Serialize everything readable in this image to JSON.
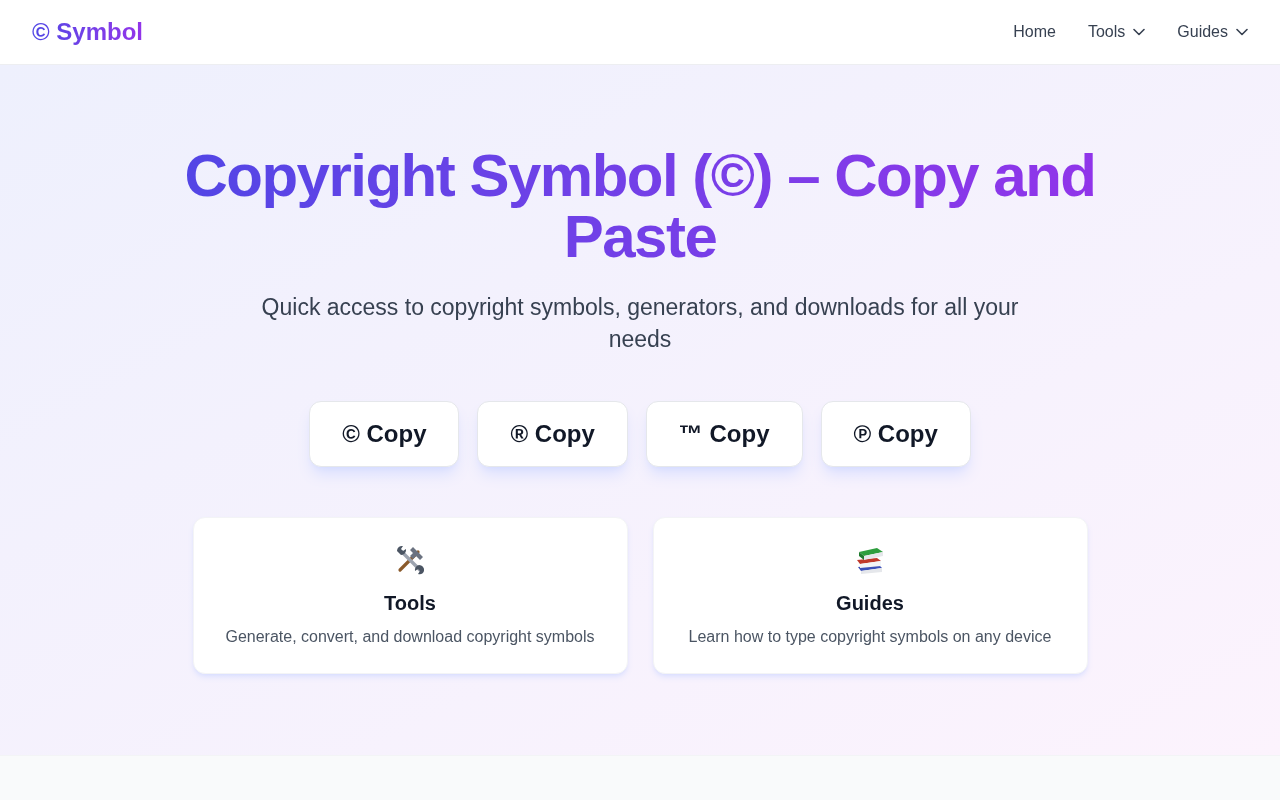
{
  "header": {
    "logo": "© Symbol",
    "nav": [
      {
        "label": "Home",
        "dropdown": false
      },
      {
        "label": "Tools",
        "dropdown": true
      },
      {
        "label": "Guides",
        "dropdown": true
      }
    ]
  },
  "hero": {
    "title": "Copyright Symbol (©) – Copy and Paste",
    "subtitle": "Quick access to copyright symbols, generators, and downloads for all your needs",
    "copy_buttons": [
      "© Copy",
      "® Copy",
      "™ Copy",
      "℗ Copy"
    ],
    "cards": [
      {
        "kind": "tools",
        "title": "Tools",
        "description": "Generate, convert, and download copyright symbols"
      },
      {
        "kind": "books",
        "title": "Guides",
        "description": "Learn how to type copyright symbols on any device"
      }
    ]
  }
}
